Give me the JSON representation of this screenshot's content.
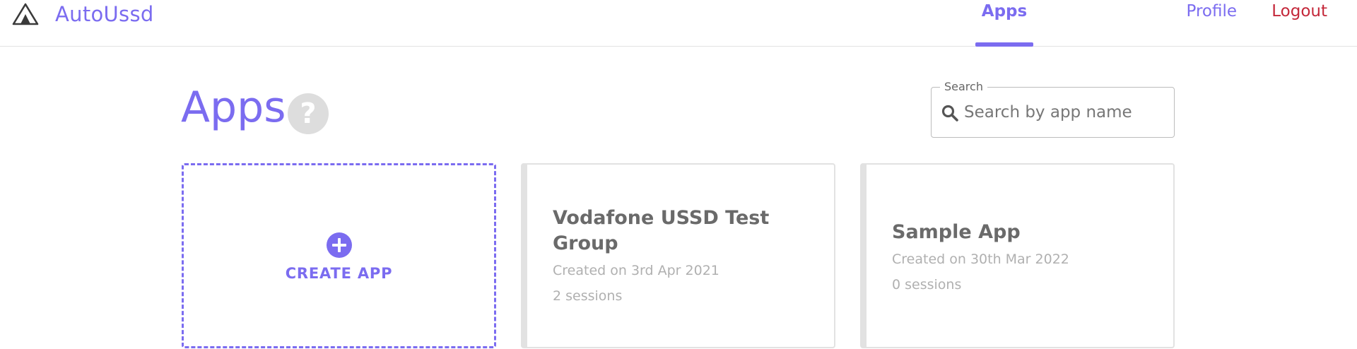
{
  "brand": {
    "name": "AutoUssd",
    "logo_icon": "mountain-logo-icon"
  },
  "nav": {
    "items": [
      {
        "label": "Apps",
        "active": true
      },
      {
        "label": "Profile",
        "active": false
      },
      {
        "label": "Logout",
        "active": false
      }
    ]
  },
  "page": {
    "title": "Apps",
    "help_glyph": "?"
  },
  "search": {
    "label": "Search",
    "placeholder": "Search by app name",
    "value": ""
  },
  "create": {
    "label": "CREATE APP"
  },
  "apps": [
    {
      "name": "Vodafone USSD Test Group",
      "created": "Created on 3rd Apr 2021",
      "sessions": "2 sessions"
    },
    {
      "name": "Sample App",
      "created": "Created on 30th Mar 2022",
      "sessions": "0 sessions"
    }
  ],
  "colors": {
    "accent": "#7b6cf0",
    "logout": "#c4283a",
    "card_border": "#e2e2e2",
    "muted_text": "#b0b0b0"
  }
}
